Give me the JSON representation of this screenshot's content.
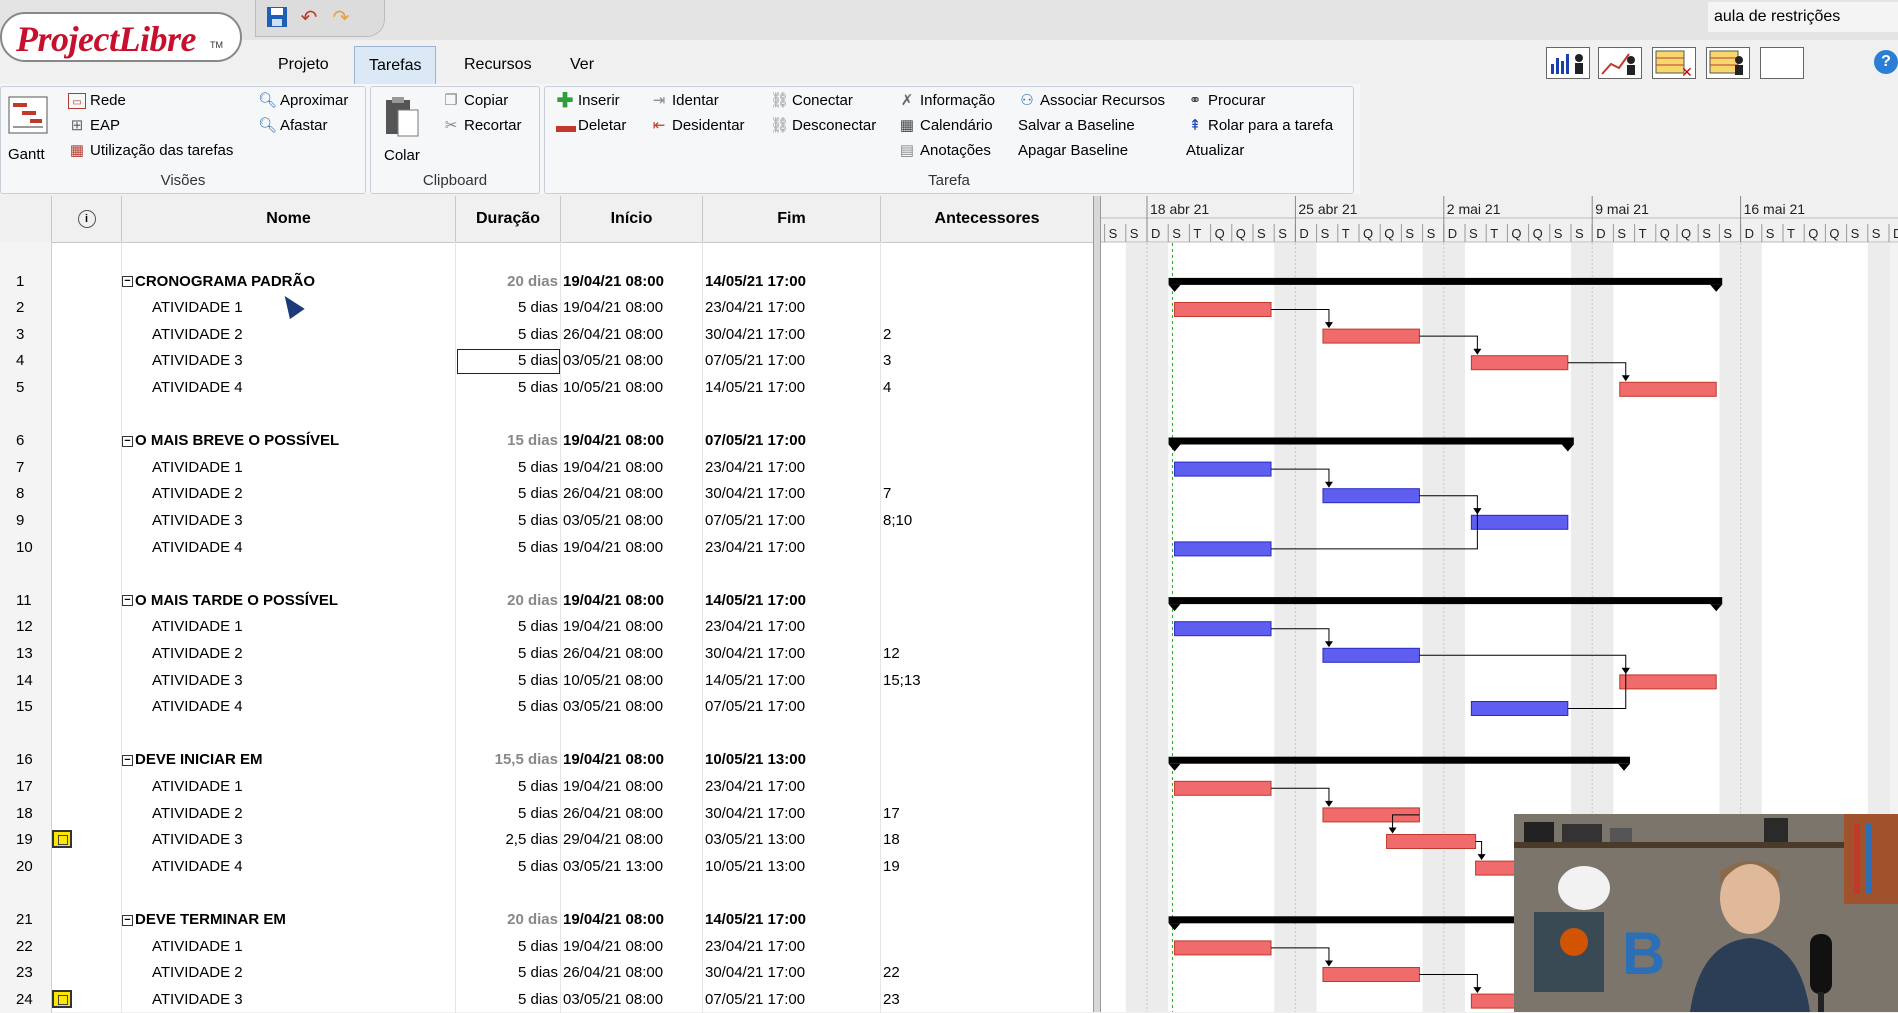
{
  "app": {
    "logo_text": "ProjectLibre",
    "logo_tm": "TM",
    "project_name": "aula de restrições"
  },
  "tabs": [
    {
      "label": "Projeto"
    },
    {
      "label": "Tarefas",
      "active": true
    },
    {
      "label": "Recursos"
    },
    {
      "label": "Ver"
    }
  ],
  "ribbon": {
    "visoes": {
      "label": "Visões",
      "gantt": "Gantt",
      "rede": "Rede",
      "eap": "EAP",
      "utilizacao": "Utilização das tarefas",
      "aproximar": "Aproximar",
      "afastar": "Afastar"
    },
    "clipboard": {
      "label": "Clipboard",
      "colar": "Colar",
      "copiar": "Copiar",
      "recortar": "Recortar"
    },
    "tarefa": {
      "label": "Tarefa",
      "inserir": "Inserir",
      "deletar": "Deletar",
      "identar": "Identar",
      "desidentar": "Desidentar",
      "conectar": "Conectar",
      "desconectar": "Desconectar",
      "informacao": "Informação",
      "calendario": "Calendário",
      "anotacoes": "Anotações",
      "associar": "Associar Recursos",
      "salvar_baseline": "Salvar a Baseline",
      "apagar_baseline": "Apagar Baseline",
      "procurar": "Procurar",
      "rolar": "Rolar para a tarefa",
      "atualizar": "Atualizar"
    }
  },
  "table": {
    "headers": {
      "nome": "Nome",
      "duracao": "Duração",
      "inicio": "Início",
      "fim": "Fim",
      "antecessores": "Antecessores"
    },
    "rows": [
      {
        "id": "",
        "blank": true
      },
      {
        "id": "1",
        "summary": true,
        "name": "CRONOGRAMA PADRÃO",
        "dur": "20 dias",
        "ini": "19/04/21 08:00",
        "fim": "14/05/21 17:00",
        "ant": ""
      },
      {
        "id": "2",
        "name": "ATIVIDADE 1",
        "dur": "5 dias",
        "ini": "19/04/21 08:00",
        "fim": "23/04/21 17:00",
        "ant": ""
      },
      {
        "id": "3",
        "name": "ATIVIDADE 2",
        "dur": "5 dias",
        "ini": "26/04/21 08:00",
        "fim": "30/04/21 17:00",
        "ant": "2"
      },
      {
        "id": "4",
        "name": "ATIVIDADE 3",
        "dur": "5 dias",
        "ini": "03/05/21 08:00",
        "fim": "07/05/21 17:00",
        "ant": "3",
        "selected": true
      },
      {
        "id": "5",
        "name": "ATIVIDADE 4",
        "dur": "5 dias",
        "ini": "10/05/21 08:00",
        "fim": "14/05/21 17:00",
        "ant": "4"
      },
      {
        "id": "",
        "blank": true
      },
      {
        "id": "6",
        "summary": true,
        "name": "O MAIS BREVE O POSSÍVEL",
        "dur": "15 dias",
        "ini": "19/04/21 08:00",
        "fim": "07/05/21 17:00",
        "ant": ""
      },
      {
        "id": "7",
        "name": "ATIVIDADE 1",
        "dur": "5 dias",
        "ini": "19/04/21 08:00",
        "fim": "23/04/21 17:00",
        "ant": ""
      },
      {
        "id": "8",
        "name": "ATIVIDADE 2",
        "dur": "5 dias",
        "ini": "26/04/21 08:00",
        "fim": "30/04/21 17:00",
        "ant": "7"
      },
      {
        "id": "9",
        "name": "ATIVIDADE 3",
        "dur": "5 dias",
        "ini": "03/05/21 08:00",
        "fim": "07/05/21 17:00",
        "ant": "8;10"
      },
      {
        "id": "10",
        "name": "ATIVIDADE 4",
        "dur": "5 dias",
        "ini": "19/04/21 08:00",
        "fim": "23/04/21 17:00",
        "ant": ""
      },
      {
        "id": "",
        "blank": true
      },
      {
        "id": "11",
        "summary": true,
        "name": "O MAIS TARDE  O POSSÍVEL",
        "dur": "20 dias",
        "ini": "19/04/21 08:00",
        "fim": "14/05/21 17:00",
        "ant": ""
      },
      {
        "id": "12",
        "name": "ATIVIDADE 1",
        "dur": "5 dias",
        "ini": "19/04/21 08:00",
        "fim": "23/04/21 17:00",
        "ant": ""
      },
      {
        "id": "13",
        "name": "ATIVIDADE 2",
        "dur": "5 dias",
        "ini": "26/04/21 08:00",
        "fim": "30/04/21 17:00",
        "ant": "12"
      },
      {
        "id": "14",
        "name": "ATIVIDADE 3",
        "dur": "5 dias",
        "ini": "10/05/21 08:00",
        "fim": "14/05/21 17:00",
        "ant": "15;13"
      },
      {
        "id": "15",
        "name": "ATIVIDADE 4",
        "dur": "5 dias",
        "ini": "03/05/21 08:00",
        "fim": "07/05/21 17:00",
        "ant": ""
      },
      {
        "id": "",
        "blank": true
      },
      {
        "id": "16",
        "summary": true,
        "name": "DEVE INICIAR EM",
        "dur": "15,5 dias",
        "ini": "19/04/21 08:00",
        "fim": "10/05/21 13:00",
        "ant": ""
      },
      {
        "id": "17",
        "name": "ATIVIDADE 1",
        "dur": "5 dias",
        "ini": "19/04/21 08:00",
        "fim": "23/04/21 17:00",
        "ant": ""
      },
      {
        "id": "18",
        "name": "ATIVIDADE 2",
        "dur": "5 dias",
        "ini": "26/04/21 08:00",
        "fim": "30/04/21 17:00",
        "ant": "17"
      },
      {
        "id": "19",
        "name": "ATIVIDADE 3",
        "dur": "2,5 dias",
        "ini": "29/04/21 08:00",
        "fim": "03/05/21 13:00",
        "ant": "18",
        "constraint": true
      },
      {
        "id": "20",
        "name": "ATIVIDADE 4",
        "dur": "5 dias",
        "ini": "03/05/21 13:00",
        "fim": "10/05/21 13:00",
        "ant": "19"
      },
      {
        "id": "",
        "blank": true
      },
      {
        "id": "21",
        "summary": true,
        "name": "DEVE TERMINAR EM",
        "dur": "20 dias",
        "ini": "19/04/21 08:00",
        "fim": "14/05/21 17:00",
        "ant": ""
      },
      {
        "id": "22",
        "name": "ATIVIDADE 1",
        "dur": "5 dias",
        "ini": "19/04/21 08:00",
        "fim": "23/04/21 17:00",
        "ant": ""
      },
      {
        "id": "23",
        "name": "ATIVIDADE 2",
        "dur": "5 dias",
        "ini": "26/04/21 08:00",
        "fim": "30/04/21 17:00",
        "ant": "22"
      },
      {
        "id": "24",
        "name": "ATIVIDADE 3",
        "dur": "5 dias",
        "ini": "03/05/21 08:00",
        "fim": "07/05/21 17:00",
        "ant": "23",
        "constraint": true
      }
    ]
  },
  "gantt": {
    "weeks": [
      "18 abr 21",
      "25 abr 21",
      "2 mai 21",
      "9 mai 21",
      "16 mai 21"
    ],
    "day_letters": [
      "D",
      "S",
      "T",
      "Q",
      "Q",
      "S",
      "S"
    ],
    "lead_days": [
      "S",
      "S"
    ],
    "colors": {
      "critical": "#f06b6b",
      "normal": "#5e5ef0",
      "summary": "#000000",
      "today_line": "#22aa22"
    }
  }
}
